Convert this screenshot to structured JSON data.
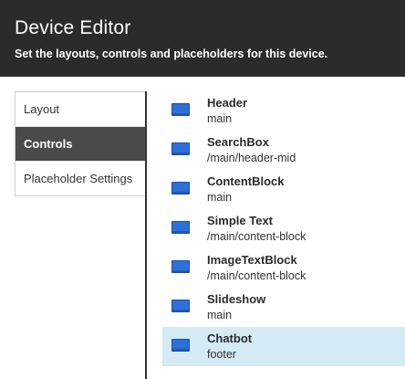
{
  "header": {
    "title": "Device Editor",
    "subtitle": "Set the layouts, controls and placeholders for this device."
  },
  "tabs": [
    {
      "label": "Layout",
      "active": false
    },
    {
      "label": "Controls",
      "active": true
    },
    {
      "label": "Placeholder Settings",
      "active": false
    }
  ],
  "controls": [
    {
      "name": "Header",
      "path": "main",
      "icon": "control-icon",
      "selected": false
    },
    {
      "name": "SearchBox",
      "path": "/main/header-mid",
      "icon": "control-icon",
      "selected": false
    },
    {
      "name": "ContentBlock",
      "path": "main",
      "icon": "control-icon",
      "selected": false
    },
    {
      "name": "Simple Text",
      "path": "/main/content-block",
      "icon": "control-icon",
      "selected": false
    },
    {
      "name": "ImageTextBlock",
      "path": "/main/content-block",
      "icon": "control-icon",
      "selected": false
    },
    {
      "name": "Slideshow",
      "path": "main",
      "icon": "control-icon",
      "selected": false
    },
    {
      "name": "Chatbot",
      "path": "footer",
      "icon": "control-icon",
      "selected": true
    }
  ],
  "colors": {
    "header_bg": "#2b2b2b",
    "active_tab_bg": "#4a4a4a",
    "selected_row_bg": "#d4eaf5",
    "icon_blue": "#2f6fd8"
  }
}
